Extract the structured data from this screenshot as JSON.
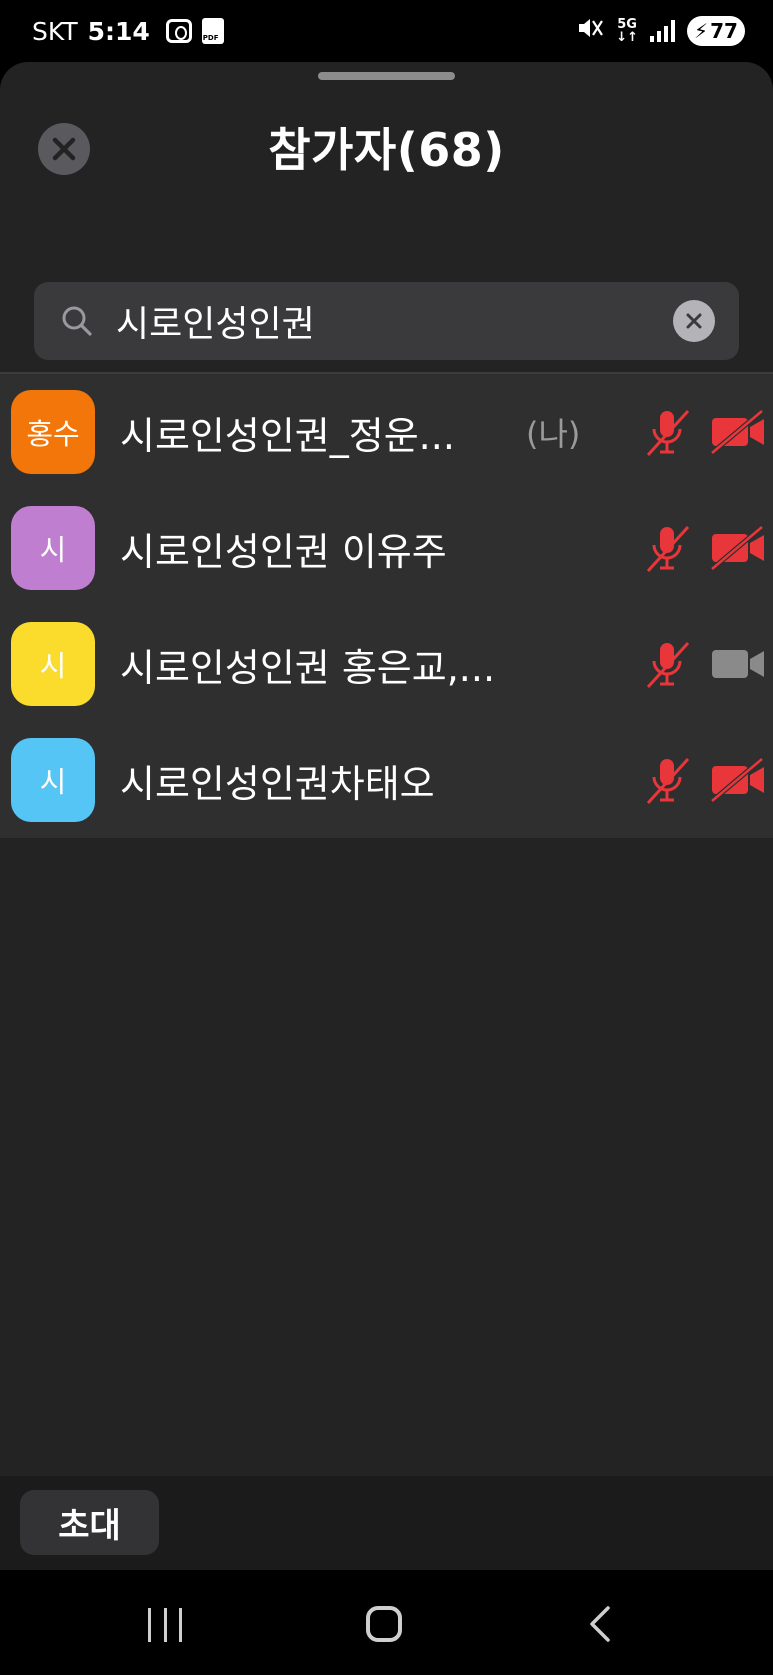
{
  "status_bar": {
    "carrier": "SKT",
    "time": "5:14",
    "network": "5G",
    "battery": "77",
    "pdf_label": "PDF"
  },
  "header": {
    "title": "참가자(68)"
  },
  "search": {
    "value": "시로인성인권"
  },
  "participants": [
    {
      "avatar_text": "홍수",
      "avatar_color": "#f2760a",
      "name": "시로인성인권_정운...",
      "is_me_label": "(나)",
      "mic_muted": true,
      "camera_off": true
    },
    {
      "avatar_text": "시",
      "avatar_color": "#c07ed0",
      "name": "시로인성인권 이유주",
      "mic_muted": true,
      "camera_off": true
    },
    {
      "avatar_text": "시",
      "avatar_color": "#fbdc2c",
      "name": "시로인성인권 홍은교,...",
      "mic_muted": true,
      "camera_off": false
    },
    {
      "avatar_text": "시",
      "avatar_color": "#55c5f5",
      "name": "시로인성인권차태오",
      "mic_muted": true,
      "camera_off": true
    }
  ],
  "footer": {
    "invite_label": "초대"
  },
  "colors": {
    "muted_red": "#e8363b",
    "camera_on_gray": "#8a8a8a",
    "sheet_bg": "#232323",
    "list_bg": "#2f2f2f"
  }
}
